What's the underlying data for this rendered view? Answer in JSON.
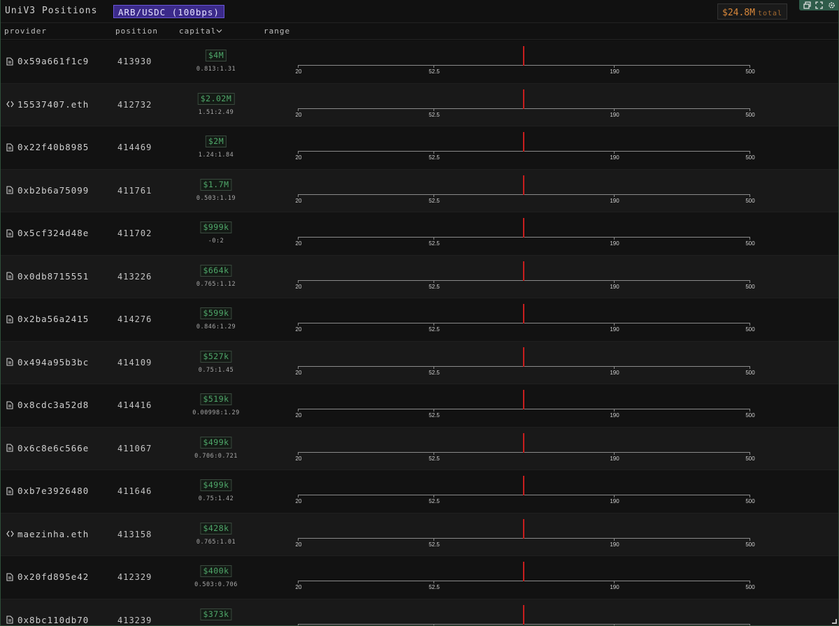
{
  "window": {
    "title": "UniV3 Positions",
    "pair": "ARB/USDC (100bps)",
    "total_value": "$24.8M",
    "total_label": "total",
    "controls": [
      "restore-icon",
      "expand-icon",
      "settings-icon"
    ]
  },
  "columns": {
    "provider": "provider",
    "position": "position",
    "capital": "capital",
    "range": "range"
  },
  "axis_ticks": [
    "20",
    "52.5",
    "190",
    "500"
  ],
  "colors": {
    "accent_purple": "#3b2a8a",
    "total_orange": "#d8873a",
    "capital_green": "#4fa86a",
    "price_marker_red": "#c81e1e"
  },
  "rows": [
    {
      "icon": "document-icon",
      "provider": "0x59a661f1c9",
      "position": "413930",
      "capital": "$4M",
      "ratio": "0.813:1.31"
    },
    {
      "icon": "code-brackets-icon",
      "provider": "15537407.eth",
      "position": "412732",
      "capital": "$2.02M",
      "ratio": "1.51:2.49"
    },
    {
      "icon": "document-icon",
      "provider": "0x22f40b8985",
      "position": "414469",
      "capital": "$2M",
      "ratio": "1.24:1.84"
    },
    {
      "icon": "document-icon",
      "provider": "0xb2b6a75099",
      "position": "411761",
      "capital": "$1.7M",
      "ratio": "0.503:1.19"
    },
    {
      "icon": "document-icon",
      "provider": "0x5cf324d48e",
      "position": "411702",
      "capital": "$999k",
      "ratio": "-0:2"
    },
    {
      "icon": "document-icon",
      "provider": "0x0db8715551",
      "position": "413226",
      "capital": "$664k",
      "ratio": "0.765:1.12"
    },
    {
      "icon": "document-icon",
      "provider": "0x2ba56a2415",
      "position": "414276",
      "capital": "$599k",
      "ratio": "0.846:1.29"
    },
    {
      "icon": "document-icon",
      "provider": "0x494a95b3bc",
      "position": "414109",
      "capital": "$527k",
      "ratio": "0.75:1.45"
    },
    {
      "icon": "document-icon",
      "provider": "0x8cdc3a52d8",
      "position": "414416",
      "capital": "$519k",
      "ratio": "0.00998:1.29"
    },
    {
      "icon": "document-icon",
      "provider": "0x6c8e6c566e",
      "position": "411067",
      "capital": "$499k",
      "ratio": "0.706:0.721"
    },
    {
      "icon": "document-icon",
      "provider": "0xb7e3926480",
      "position": "411646",
      "capital": "$499k",
      "ratio": "0.75:1.42"
    },
    {
      "icon": "code-brackets-icon",
      "provider": "maezinha.eth",
      "position": "413158",
      "capital": "$428k",
      "ratio": "0.765:1.01"
    },
    {
      "icon": "document-icon",
      "provider": "0x20fd895e42",
      "position": "412329",
      "capital": "$400k",
      "ratio": "0.503:0.706"
    },
    {
      "icon": "document-icon",
      "provider": "0x8bc110db70",
      "position": "413239",
      "capital": "$373k",
      "ratio": ""
    }
  ]
}
